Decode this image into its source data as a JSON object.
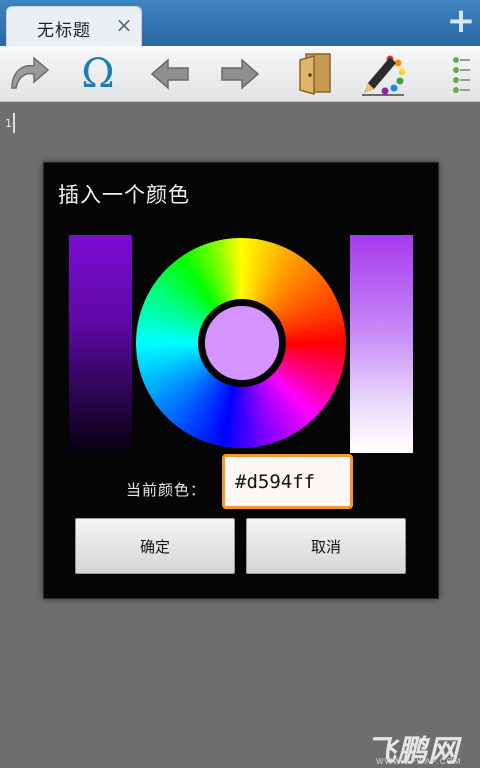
{
  "tabbar": {
    "tab_title": "无标题",
    "close_glyph": "×",
    "new_tab_glyph": "+"
  },
  "toolbar": {
    "omega_glyph": "Ω",
    "icons": [
      "redo-icon",
      "insert-symbol-icon",
      "arrow-left-icon",
      "arrow-right-icon",
      "open-file-icon",
      "color-palette-icon",
      "overflow-menu-icon"
    ]
  },
  "editor": {
    "line_number": "1"
  },
  "dialog": {
    "title": "插入一个颜色",
    "current_color_label": "当前颜色：",
    "current_color_value": "#d594ff",
    "ok_label": "确定",
    "cancel_label": "取消"
  },
  "colors": {
    "selected": "#d594ff",
    "tab_bar": "#2b68a4",
    "input_border": "#f29a30"
  },
  "watermark": {
    "logo_text": "飞鹏网",
    "site": "WWW.FPWAP.COM"
  }
}
